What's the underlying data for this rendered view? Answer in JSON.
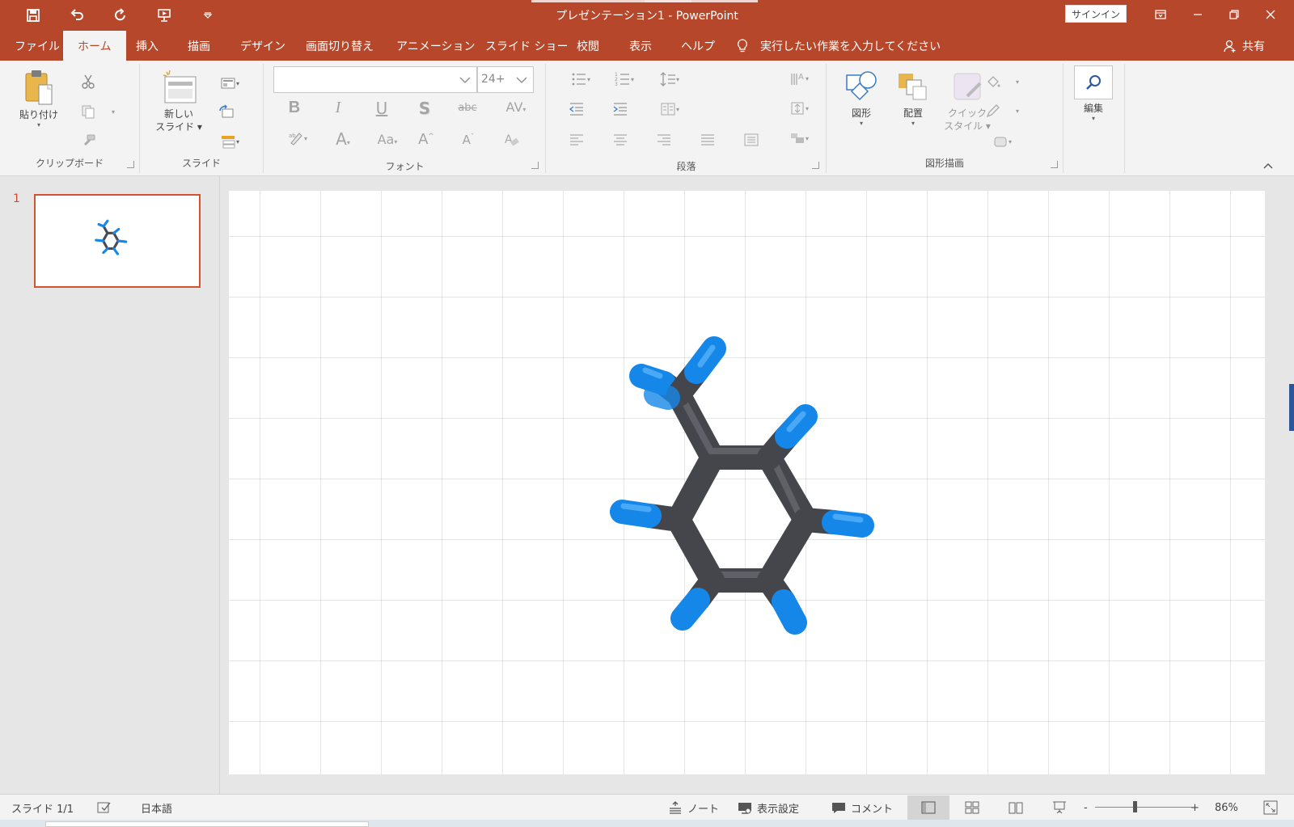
{
  "app": {
    "title": "プレゼンテーション1  -  PowerPoint",
    "signin_label": "サインイン",
    "accent_color": "#b7472a"
  },
  "qat": {
    "icons": [
      "save-icon",
      "undo-icon",
      "redo-icon",
      "present-from-start-icon",
      "customize-qat-icon"
    ]
  },
  "tabs": [
    "ファイル",
    "ホーム",
    "挿入",
    "描画",
    "デザイン",
    "画面切り替え",
    "アニメーション",
    "スライド ショー",
    "校閲",
    "表示",
    "ヘルプ"
  ],
  "active_tab": "ホーム",
  "tellme": {
    "text": "実行したい作業を入力してください"
  },
  "share": {
    "label": "共有"
  },
  "ribbon": {
    "clipboard": {
      "paste": "貼り付け",
      "group": "クリップボード"
    },
    "slides": {
      "new_slide_line1": "新しい",
      "new_slide_line2": "スライド",
      "group": "スライド"
    },
    "font": {
      "name_value": "",
      "size_value": "24+",
      "group": "フォント",
      "bold": "B",
      "italic": "I",
      "underline": "U",
      "shadow": "S",
      "strike": "abc",
      "spacing": "AV",
      "color_a": "A",
      "case": "Aa",
      "grow": "A",
      "shrink": "A"
    },
    "paragraph": {
      "group": "段落"
    },
    "drawing": {
      "shapes": "図形",
      "arrange": "配置",
      "quick_line1": "クイック",
      "quick_line2": "スタイル",
      "group": "図形描画"
    },
    "editing": {
      "label": "編集"
    }
  },
  "slides_pane": {
    "slide_number": "1"
  },
  "statusbar": {
    "slide_info": "スライド 1/1",
    "language": "日本語",
    "notes": "ノート",
    "display_settings": "表示設定",
    "comments": "コメント",
    "zoom_minus": "-",
    "zoom_plus": "+",
    "zoom_percent": "86%",
    "zoom_level": 86
  }
}
